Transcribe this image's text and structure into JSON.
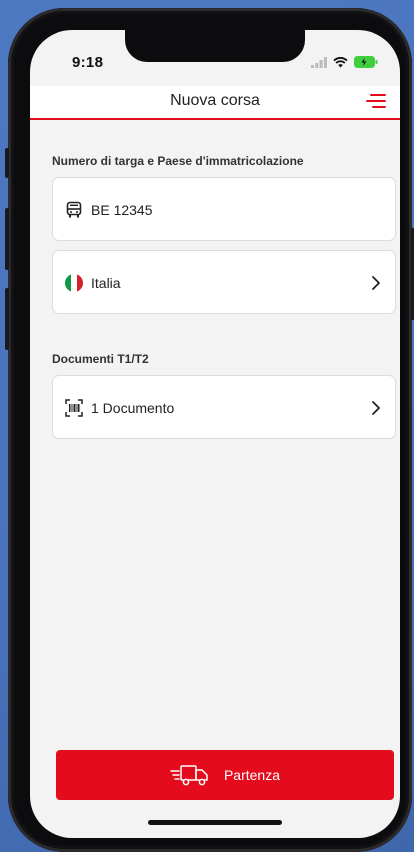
{
  "status_bar": {
    "time": "9:18"
  },
  "header": {
    "title": "Nuova corsa"
  },
  "plate_section": {
    "label": "Numero di targa e Paese d'immatricolazione",
    "plate_value": "BE 12345",
    "country_value": "Italia"
  },
  "documents_section": {
    "label": "Documenti T1/T2",
    "documents_value": "1 Documento"
  },
  "cta": {
    "label": "Partenza"
  },
  "colors": {
    "accent": "#e30b1c",
    "background": "#f3f3f3",
    "card": "#ffffff"
  },
  "icons": [
    "bus-icon",
    "italy-flag-icon",
    "barcode-scan-icon",
    "chevron-right-icon",
    "delivery-truck-icon",
    "menu-icon",
    "signal-icon",
    "wifi-icon",
    "battery-icon"
  ]
}
